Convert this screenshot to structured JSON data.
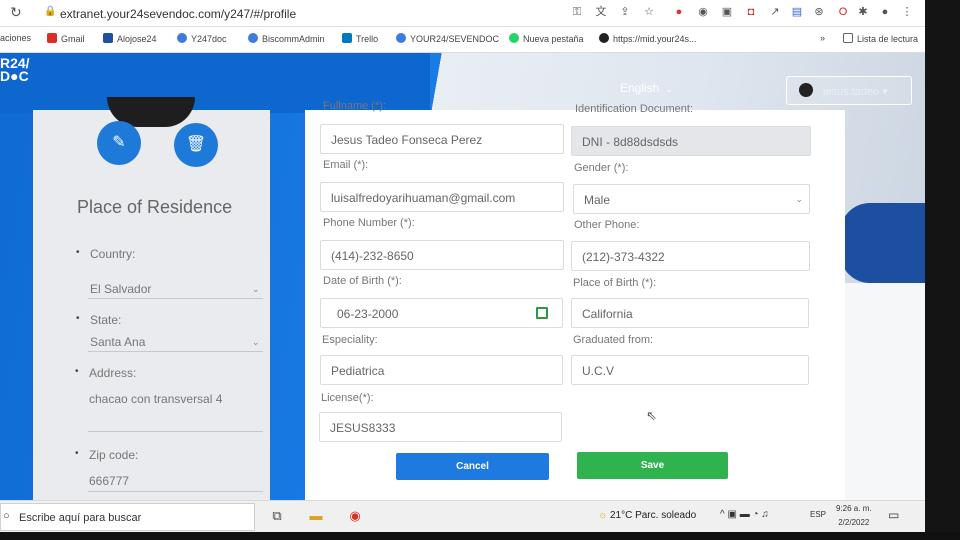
{
  "browser": {
    "url": "extranet.your24sevendoc.com/y247/#/profile",
    "bookmarks": [
      {
        "label": "aciones",
        "color": ""
      },
      {
        "label": "Gmail",
        "color": "#d93025"
      },
      {
        "label": "Alojose24",
        "color": "#1e4fa0"
      },
      {
        "label": "Y247doc",
        "color": "#3d7be0"
      },
      {
        "label": "BiscommAdmin",
        "color": "#3d7be0"
      },
      {
        "label": "Trello",
        "color": "#0079bf"
      },
      {
        "label": "YOUR24/SEVENDOC",
        "color": "#3d7be0"
      },
      {
        "label": "Nueva pestaña",
        "color": "#25d366"
      },
      {
        "label": "https://mid.your24s...",
        "color": "#222222"
      }
    ],
    "reading_list": "Lista de lectura"
  },
  "header": {
    "logo_line1": "R24/",
    "logo_line2": "D●C",
    "language": "English",
    "user_name": "jesus.tadeo"
  },
  "sidebar": {
    "edit_icon": "edit-icon",
    "delete_icon": "trash-icon",
    "title": "Place of Residence",
    "country_label": "Country:",
    "country_value": "El Salvador",
    "state_label": "State:",
    "state_value": "Santa Ana",
    "address_label": "Address:",
    "address_value": "chacao con transversal 4",
    "zip_label": "Zip code:",
    "zip_value": "666777"
  },
  "form": {
    "fullname_label": "Fullname (*):",
    "fullname_value": "Jesus Tadeo Fonseca Perez",
    "id_label": "Identification Document:",
    "id_value": "DNI - 8d88dsdsds",
    "email_label": "Email (*):",
    "email_value": "luisalfredoyarihuaman@gmail.com",
    "gender_label": "Gender (*):",
    "gender_value": "Male",
    "phone_label": "Phone Number (*):",
    "phone_value": "(414)-232-8650",
    "other_phone_label": "Other Phone:",
    "other_phone_value": "(212)-373-4322",
    "dob_label": "Date of Birth (*):",
    "dob_value": "06-23-2000",
    "pob_label": "Place of Birth (*):",
    "pob_value": "California",
    "specialty_label": "Especiality:",
    "specialty_value": "Pediatrica",
    "graduated_label": "Graduated from:",
    "graduated_value": "U.C.V",
    "license_label": "License(*):",
    "license_value": "JESUS8333",
    "cancel_label": "Cancel",
    "save_label": "Save"
  },
  "taskbar": {
    "search_placeholder": "Escribe aquí para buscar",
    "weather": "21°C  Parc. soleado",
    "lang": "ESP",
    "time": "9:26 a. m.",
    "date": "2/2/2022"
  },
  "colors": {
    "primary_blue": "#1e7ad8",
    "save_green": "#2fb34e",
    "cancel_blue": "#1f7ae0"
  }
}
